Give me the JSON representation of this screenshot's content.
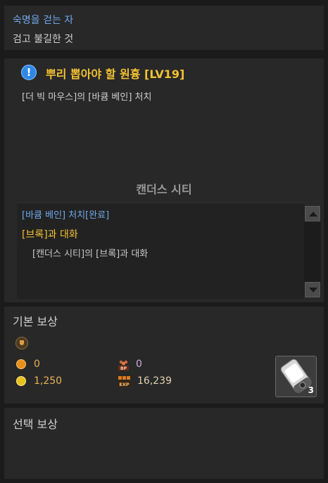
{
  "header": {
    "subtitle": "숙명을 걷는 자",
    "title": "검고 불길한 것"
  },
  "quest": {
    "icon": "exclamation-icon",
    "title": "뿌리 뽑아야 할 원흉 [LV19]",
    "description": "[더 빅 마우스]의 [바큠 베인] 처치",
    "region": "캔더스 시티",
    "objectives": [
      {
        "text": "[바큠 베인] 처치[완료]",
        "status": "complete",
        "color": "#6fa8ea"
      },
      {
        "text": "[브록]과 대화",
        "status": "active",
        "color": "#f2c232"
      },
      {
        "text": "[캔더스 시티]의 [브록]과 대화",
        "status": "detail"
      }
    ]
  },
  "rewards": {
    "title": "기본 보상",
    "medal": "0",
    "bp": "0",
    "gold": "1,250",
    "exp": "16,239",
    "item": {
      "icon": "canister-icon",
      "count": "3"
    }
  },
  "selection": {
    "title": "선택 보상"
  }
}
